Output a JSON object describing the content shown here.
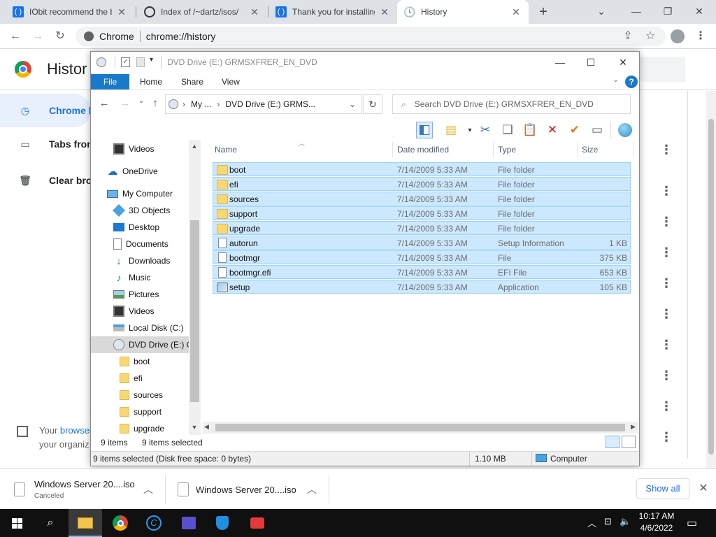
{
  "browser": {
    "tabs": [
      {
        "title": "IObit recommend the b",
        "active": false
      },
      {
        "title": "Index of /~dartz/isos/",
        "active": false
      },
      {
        "title": "Thank you for installing",
        "active": false
      },
      {
        "title": "History",
        "active": true
      }
    ],
    "omnibox": {
      "site": "Chrome",
      "url": "chrome://history"
    }
  },
  "history_page": {
    "title": "Histor",
    "sidebar": [
      {
        "label": "Chrome h",
        "icon": "clock-icon",
        "selected": true
      },
      {
        "label": "Tabs from",
        "icon": "devices-icon",
        "selected": false
      },
      {
        "label": "Clear brov",
        "icon": "trash-icon",
        "selected": false
      }
    ],
    "managed_prefix": "Your ",
    "managed_link": "browser",
    "managed_line2": "your organiz"
  },
  "explorer": {
    "title": "DVD Drive (E:) GRMSXFRER_EN_DVD",
    "ribbon_tabs": [
      "File",
      "Home",
      "Share",
      "View"
    ],
    "address": {
      "crumb1": "My ...",
      "crumb2": "DVD Drive (E:) GRMS..."
    },
    "search_placeholder": "Search DVD Drive (E:) GRMSXFRER_EN_DVD",
    "nav": [
      {
        "label": "Videos",
        "indent": 1,
        "icon": "video-icon"
      },
      {
        "label": "OneDrive",
        "indent": 0,
        "icon": "cloud-icon"
      },
      {
        "label": "My Computer",
        "indent": 0,
        "icon": "computer-icon"
      },
      {
        "label": "3D Objects",
        "indent": 1,
        "icon": "cube-icon"
      },
      {
        "label": "Desktop",
        "indent": 1,
        "icon": "desktop-icon"
      },
      {
        "label": "Documents",
        "indent": 1,
        "icon": "document-icon"
      },
      {
        "label": "Downloads",
        "indent": 1,
        "icon": "download-icon"
      },
      {
        "label": "Music",
        "indent": 1,
        "icon": "music-icon"
      },
      {
        "label": "Pictures",
        "indent": 1,
        "icon": "picture-icon"
      },
      {
        "label": "Videos",
        "indent": 1,
        "icon": "video-icon"
      },
      {
        "label": "Local Disk (C:)",
        "indent": 1,
        "icon": "disk-icon"
      },
      {
        "label": "DVD Drive (E:) GI",
        "indent": 1,
        "icon": "dvd-icon"
      },
      {
        "label": "boot",
        "indent": 2,
        "icon": "folder-icon"
      },
      {
        "label": "efi",
        "indent": 2,
        "icon": "folder-icon"
      },
      {
        "label": "sources",
        "indent": 2,
        "icon": "folder-icon"
      },
      {
        "label": "support",
        "indent": 2,
        "icon": "folder-icon"
      },
      {
        "label": "upgrade",
        "indent": 2,
        "icon": "folder-icon"
      }
    ],
    "columns": [
      "Name",
      "Date modified",
      "Type",
      "Size"
    ],
    "files": [
      {
        "name": "boot",
        "date": "7/14/2009 5:33 AM",
        "type": "File folder",
        "size": "",
        "icon": "folder-icon"
      },
      {
        "name": "efi",
        "date": "7/14/2009 5:33 AM",
        "type": "File folder",
        "size": "",
        "icon": "folder-icon"
      },
      {
        "name": "sources",
        "date": "7/14/2009 5:33 AM",
        "type": "File folder",
        "size": "",
        "icon": "folder-icon"
      },
      {
        "name": "support",
        "date": "7/14/2009 5:33 AM",
        "type": "File folder",
        "size": "",
        "icon": "folder-icon"
      },
      {
        "name": "upgrade",
        "date": "7/14/2009 5:33 AM",
        "type": "File folder",
        "size": "",
        "icon": "folder-icon"
      },
      {
        "name": "autorun",
        "date": "7/14/2009 5:33 AM",
        "type": "Setup Information",
        "size": "1 KB",
        "icon": "file-icon"
      },
      {
        "name": "bootmgr",
        "date": "7/14/2009 5:33 AM",
        "type": "File",
        "size": "375 KB",
        "icon": "file-icon"
      },
      {
        "name": "bootmgr.efi",
        "date": "7/14/2009 5:33 AM",
        "type": "EFI File",
        "size": "653 KB",
        "icon": "file-icon"
      },
      {
        "name": "setup",
        "date": "7/14/2009 5:33 AM",
        "type": "Application",
        "size": "105 KB",
        "icon": "setup-icon"
      }
    ],
    "status_items": "9 items",
    "status_selected": "9 items selected",
    "status_bar_left": "9 items selected (Disk free space: 0 bytes)",
    "status_bar_size": "1.10 MB",
    "status_bar_location": "Computer"
  },
  "downloads": [
    {
      "name": "Windows Server 20....iso",
      "status": "Canceled"
    },
    {
      "name": "Windows Server 20....iso",
      "status": ""
    }
  ],
  "show_all_label": "Show all",
  "taskbar": {
    "time": "10:17 AM",
    "date": "4/6/2022"
  },
  "colors": {
    "selection": "#cce8ff",
    "ribbon_file": "#1979ca",
    "chrome_blue": "#1a73e8"
  }
}
